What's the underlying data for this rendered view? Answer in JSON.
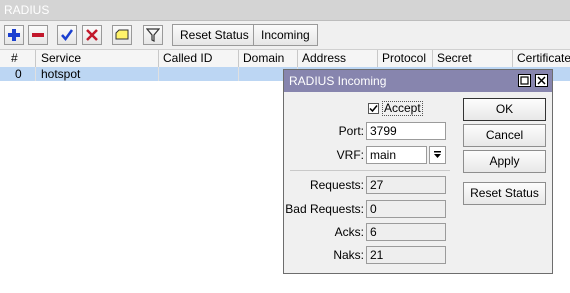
{
  "window": {
    "title": "RADIUS"
  },
  "toolbar": {
    "reset_status_label": "Reset Status",
    "incoming_label": "Incoming"
  },
  "table": {
    "columns": [
      "#",
      "Service",
      "Called ID",
      "Domain",
      "Address",
      "Protocol",
      "Secret",
      "Certificate"
    ],
    "rows": [
      {
        "num": "0",
        "service": "hotspot"
      }
    ]
  },
  "dialog": {
    "title": "RADIUS Incoming",
    "accept_label": "Accept",
    "port_label": "Port:",
    "port_value": "3799",
    "vrf_label": "VRF:",
    "vrf_value": "main",
    "requests_label": "Requests:",
    "requests_value": "27",
    "bad_requests_label": "Bad Requests:",
    "bad_requests_value": "0",
    "acks_label": "Acks:",
    "acks_value": "6",
    "naks_label": "Naks:",
    "naks_value": "21",
    "ok_label": "OK",
    "cancel_label": "Cancel",
    "apply_label": "Apply",
    "reset_status_label": "Reset Status"
  },
  "colors": {
    "dialog_title_bg": "#8785ae",
    "selected_row": "#bcd6f3"
  }
}
